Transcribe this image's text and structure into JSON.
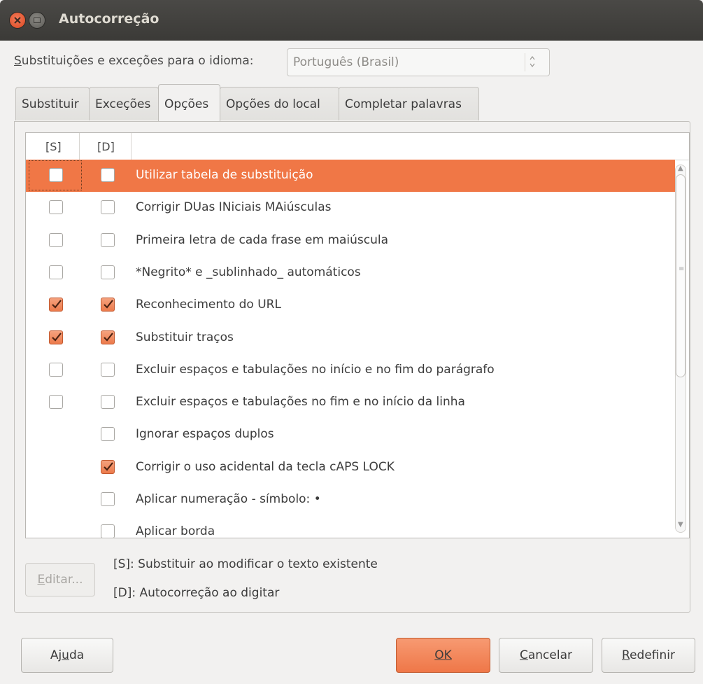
{
  "window": {
    "title": "Autocorreção"
  },
  "language": {
    "label_prefix": "",
    "label_mnemonic": "S",
    "label_rest": "ubstituições e exceções para o idioma:",
    "selected": "Português (Brasil)"
  },
  "tabs": [
    {
      "label": "Substituir"
    },
    {
      "label": "Exceções"
    },
    {
      "label": "Opções"
    },
    {
      "label": "Opções do local"
    },
    {
      "label": "Completar palavras"
    }
  ],
  "active_tab": "Opções",
  "list": {
    "col_s": "[S]",
    "col_d": "[D]",
    "rows": [
      {
        "label": "Utilizar tabela de substituição",
        "s": false,
        "d": false,
        "has_s": true,
        "selected": true
      },
      {
        "label": "Corrigir DUas INiciais MAiúsculas",
        "s": false,
        "d": false,
        "has_s": true
      },
      {
        "label": "Primeira letra de cada frase em maiúscula",
        "s": false,
        "d": false,
        "has_s": true
      },
      {
        "label": "*Negrito* e _sublinhado_ automáticos",
        "s": false,
        "d": false,
        "has_s": true
      },
      {
        "label": "Reconhecimento do URL",
        "s": true,
        "d": true,
        "has_s": true
      },
      {
        "label": "Substituir traços",
        "s": true,
        "d": true,
        "has_s": true
      },
      {
        "label": "Excluir espaços e tabulações no início e no fim do parágrafo",
        "s": false,
        "d": false,
        "has_s": true
      },
      {
        "label": "Excluir espaços e tabulações no fim e no início da linha",
        "s": false,
        "d": false,
        "has_s": true
      },
      {
        "label": "Ignorar espaços duplos",
        "d": false,
        "has_s": false
      },
      {
        "label": "Corrigir o uso acidental da tecla cAPS LOCK",
        "d": true,
        "has_s": false
      },
      {
        "label": "Aplicar numeração - símbolo: •",
        "d": false,
        "has_s": false
      },
      {
        "label": "Aplicar borda",
        "d": false,
        "has_s": false
      }
    ]
  },
  "edit_button": {
    "mnemonic": "E",
    "rest": "ditar..."
  },
  "legend": {
    "s": "[S]: Substituir ao modificar o texto existente",
    "d": "[D]: Autocorreção ao digitar"
  },
  "buttons": {
    "help": {
      "pre": "Aj",
      "mnemonic": "u",
      "post": "da"
    },
    "ok": {
      "pre": "",
      "mnemonic": "O",
      "post": "K"
    },
    "cancel": {
      "pre": "",
      "mnemonic": "C",
      "post": "ancelar"
    },
    "reset": {
      "pre": "",
      "mnemonic": "R",
      "post": "edefinir"
    }
  },
  "colors": {
    "accent": "#f07746",
    "titlebar": "#3c3b37",
    "background": "#f2f1f0"
  }
}
